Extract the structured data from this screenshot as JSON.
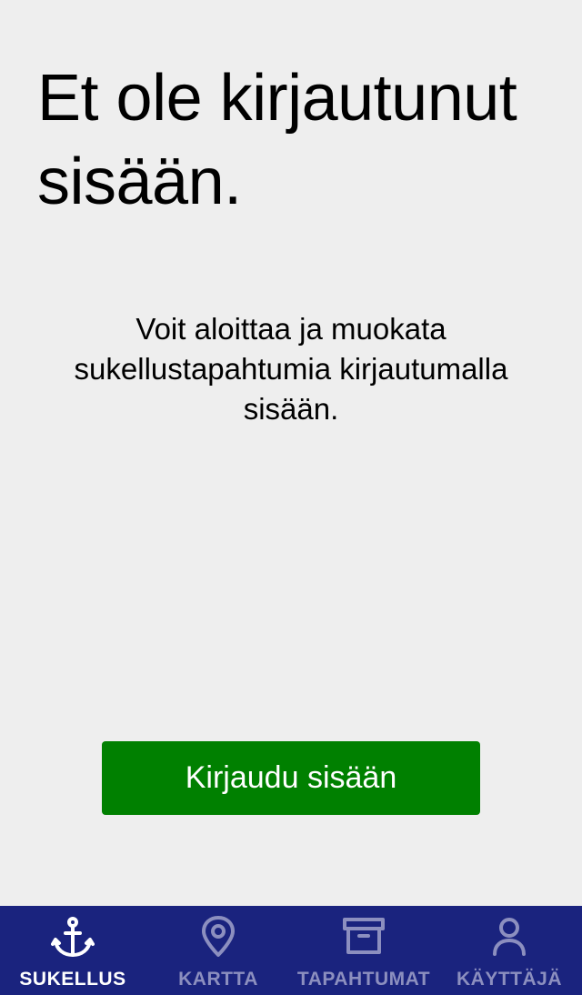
{
  "main": {
    "title": "Et ole kirjautunut sisään.",
    "description": "Voit aloittaa ja muokata sukellustapahtumia kirjautumalla sisään.",
    "login_button": "Kirjaudu sisään"
  },
  "tabbar": {
    "tabs": [
      {
        "label": "SUKELLUS",
        "icon": "anchor-icon",
        "active": true
      },
      {
        "label": "KARTTA",
        "icon": "map-pin-icon",
        "active": false
      },
      {
        "label": "TAPAHTUMAT",
        "icon": "archive-box-icon",
        "active": false
      },
      {
        "label": "KÄYTTÄJÄ",
        "icon": "user-icon",
        "active": false
      }
    ]
  },
  "colors": {
    "background": "#eeeeee",
    "button": "#008000",
    "tabbar": "#1a237e",
    "tab_active": "#ffffff",
    "tab_inactive": "#8c8fbf"
  }
}
